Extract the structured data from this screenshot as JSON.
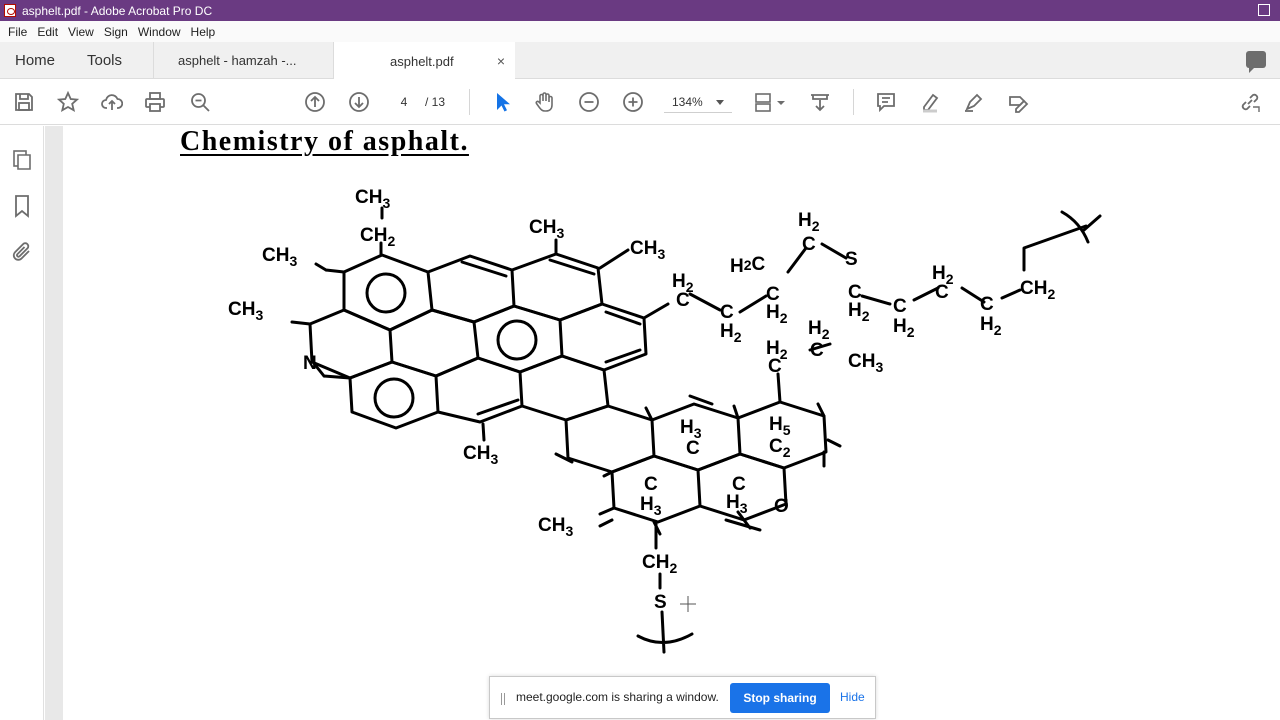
{
  "window": {
    "title": "asphelt.pdf - Adobe Acrobat Pro DC"
  },
  "menu": {
    "items": [
      "File",
      "Edit",
      "View",
      "Sign",
      "Window",
      "Help"
    ]
  },
  "tabs": {
    "home": "Home",
    "tools": "Tools",
    "doc1": "asphelt - hamzah  -...",
    "doc2": "asphelt.pdf",
    "close_glyph": "×"
  },
  "toolbar": {
    "current_page": "4",
    "total_pages": "/ 13",
    "zoom": "134%"
  },
  "document": {
    "heading": "Chemistry of asphalt.",
    "molecule_labels": {
      "ch3": "CH",
      "ch2": "CH",
      "sub3": "3",
      "sub2": "2",
      "h2": "H",
      "c": "C",
      "s": "S",
      "n": "N",
      "o": "O",
      "h3": "H",
      "h5": "H",
      "c2": "C",
      "h2c": "H2C",
      "ch3b": "CH",
      "c_h3": "C"
    }
  },
  "share_banner": {
    "message": "meet.google.com is sharing a window.",
    "stop_label": "Stop sharing",
    "hide_label": "Hide"
  },
  "colors": {
    "titlebar": "#6a3a82",
    "accent_blue": "#1a73e8",
    "select_tool": "#1473e6"
  }
}
